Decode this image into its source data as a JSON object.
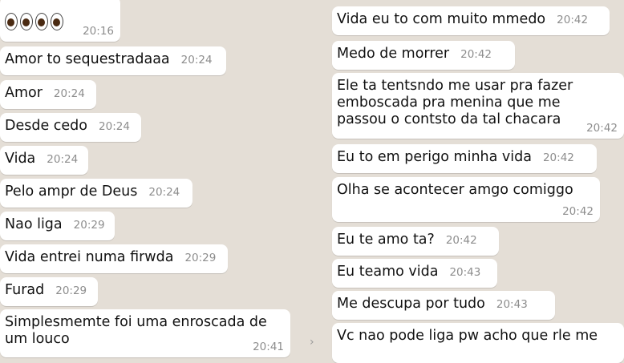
{
  "left_messages": [
    {
      "time": "20:16"
    },
    {
      "text": "Amor to sequestradaaa",
      "time": "20:24"
    },
    {
      "text": "Amor",
      "time": "20:24"
    },
    {
      "text": "Desde cedo",
      "time": "20:24"
    },
    {
      "text": "Vida",
      "time": "20:24"
    },
    {
      "text": "Pelo ampr de Deus",
      "time": "20:24"
    },
    {
      "text": "Nao liga",
      "time": "20:29"
    },
    {
      "text": "Vida entrei numa firwda",
      "time": "20:29"
    },
    {
      "text": "Furad",
      "time": "20:29"
    },
    {
      "text": "Simplesmemte foi uma enroscada de\num louco",
      "time": "20:41"
    }
  ],
  "right_messages": [
    {
      "text": "Vida eu to com muito mmedo",
      "time": "20:42"
    },
    {
      "text": "Medo de morrer",
      "time": "20:42"
    },
    {
      "text": "Ele ta tentsndo me usar pra fazer\nemboscada pra menina que me\npassou o contsto da tal chacara",
      "time": "20:42"
    },
    {
      "text": "Eu to em perigo minha vida",
      "time": "20:42"
    },
    {
      "text": "Olha se acontecer amgo comiggo",
      "time": "20:42"
    },
    {
      "text": "Eu te amo ta?",
      "time": "20:42"
    },
    {
      "text": "Eu teamo vida",
      "time": "20:43"
    },
    {
      "text": "Me descupa por tudo",
      "time": "20:43"
    },
    {
      "text": "Vc nao pode liga pw acho que rle me",
      "time": ""
    }
  ],
  "scroll_chevron": "›"
}
